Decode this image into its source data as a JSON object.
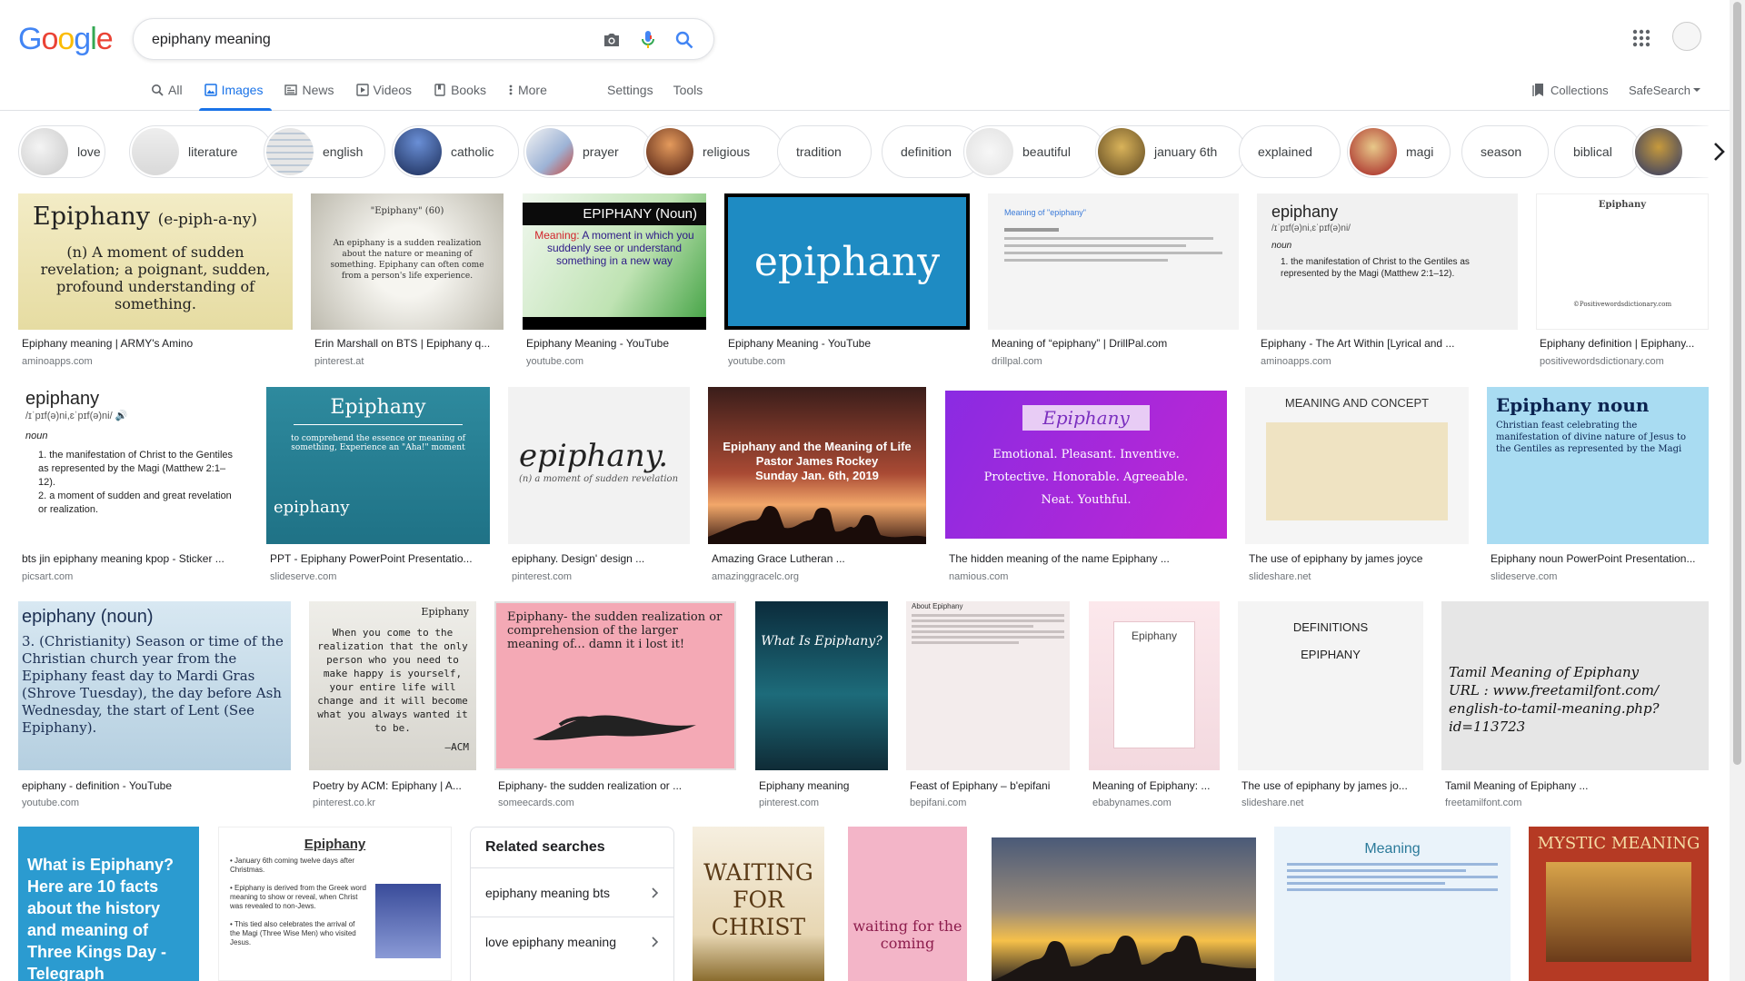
{
  "logo": {
    "text": "Google"
  },
  "search": {
    "query": "epiphany meaning"
  },
  "tabs": [
    {
      "label": "All"
    },
    {
      "label": "Images"
    },
    {
      "label": "News"
    },
    {
      "label": "Videos"
    },
    {
      "label": "Books"
    },
    {
      "label": "More"
    }
  ],
  "tools": {
    "settings": "Settings",
    "tools": "Tools"
  },
  "collections": "Collections",
  "safesearch": "SafeSearch",
  "chips": [
    "love",
    "literature",
    "english",
    "catholic",
    "prayer",
    "religious",
    "tradition",
    "definition",
    "beautiful",
    "january 6th",
    "explained",
    "magi",
    "season",
    "biblical"
  ],
  "results": [
    {
      "title": "Epiphany meaning | ARMY's Amino",
      "domain": "aminoapps.com",
      "text": "Epiphany (e-piph-a-ny)\n(n) A moment of sudden revelation; a poignant, sudden, profound understanding of something."
    },
    {
      "title": "Erin Marshall on BTS | Epiphany q...",
      "domain": "pinterest.at",
      "text": "\"Epiphany\" (60)\nAn epiphany is a sudden realization about the nature or meaning of something. Epiphany can often come from a person's life experience."
    },
    {
      "title": "Epiphany Meaning - YouTube",
      "domain": "youtube.com",
      "text": "EPIPHANY (Noun)\nMeaning: A moment in which you suddenly see or understand something in a new way"
    },
    {
      "title": "Epiphany Meaning - YouTube",
      "domain": "youtube.com",
      "text": "epiphany"
    },
    {
      "title": "Meaning of “epiphany” | DrillPal.com",
      "domain": "drillpal.com",
      "text": "Meaning of \"epiphany\""
    },
    {
      "title": "Epiphany - The Art Within [Lyrical and ...",
      "domain": "aminoapps.com",
      "text": "epiphany"
    },
    {
      "title": "Epiphany definition | Epiphany...",
      "domain": "positivewordsdictionary.com",
      "text": "Epiphany"
    },
    {
      "title": "bts jin epiphany meaning kpop - Sticker ...",
      "domain": "picsart.com",
      "text": "epiphany"
    },
    {
      "title": "PPT - Epiphany PowerPoint Presentatio...",
      "domain": "slideserve.com",
      "text": "Epiphany"
    },
    {
      "title": "epiphany. Design' design ...",
      "domain": "pinterest.com",
      "text": "epiphany."
    },
    {
      "title": "Amazing Grace Lutheran ...",
      "domain": "amazinggracelc.org",
      "text": "Epiphany and the Meaning of Life\nPastor James Rockey\nSunday Jan. 6th, 2019"
    },
    {
      "title": "The hidden meaning of the name Epiphany ...",
      "domain": "namious.com",
      "text": "Epiphany"
    },
    {
      "title": "The use of epiphany by james joyce",
      "domain": "slideshare.net",
      "text": "MEANING AND CONCEPT"
    },
    {
      "title": "Epiphany noun PowerPoint Presentation...",
      "domain": "slideserve.com",
      "text": "Epiphany noun"
    },
    {
      "title": "epiphany - definition - YouTube",
      "domain": "youtube.com",
      "text": "epiphany (noun)"
    },
    {
      "title": "Poetry by ACM: Epiphany | A...",
      "domain": "pinterest.co.kr",
      "text": "Epiphany"
    },
    {
      "title": "Epiphany- the sudden realization or ...",
      "domain": "someecards.com",
      "text": "Epiphany- the sudden realization or comprehension of the larger meaning of... damn it i lost it!"
    },
    {
      "title": "Epiphany meaning",
      "domain": "pinterest.com",
      "text": "What Is Epiphany?"
    },
    {
      "title": "Feast of Epiphany – b'epifani",
      "domain": "bepifani.com",
      "text": "About Epiphany"
    },
    {
      "title": "Meaning of Epiphany: ...",
      "domain": "ebabynames.com",
      "text": "Epiphany"
    },
    {
      "title": "The use of epiphany by james jo...",
      "domain": "slideshare.net",
      "text": "DEFINITIONS\nEPIPHANY"
    },
    {
      "title": "Tamil Meaning of Epiphany ...",
      "domain": "freetamilfont.com",
      "text": "Tamil Meaning of Epiphany\nURL : www.freetamilfont.com/ english-to-tamil-meaning.php?id=113723"
    }
  ],
  "bottom_row": {
    "telegraph": "What is Epiphany? Here are 10 facts about the history and meaning of Three Kings Day - Telegraph",
    "epiphany_list_title": "Epiphany",
    "waiting": "WAITING FOR CHRIST",
    "liturgical": "waiting for the coming",
    "meaning": "Meaning",
    "mystic": "MYSTIC MEANING"
  },
  "related": {
    "title": "Related searches",
    "items": [
      "epiphany meaning bts",
      "love epiphany meaning"
    ]
  },
  "colors": {
    "accent": "#1a73e8",
    "text": "#202124",
    "muted": "#70757a",
    "border": "#dfe1e5"
  }
}
